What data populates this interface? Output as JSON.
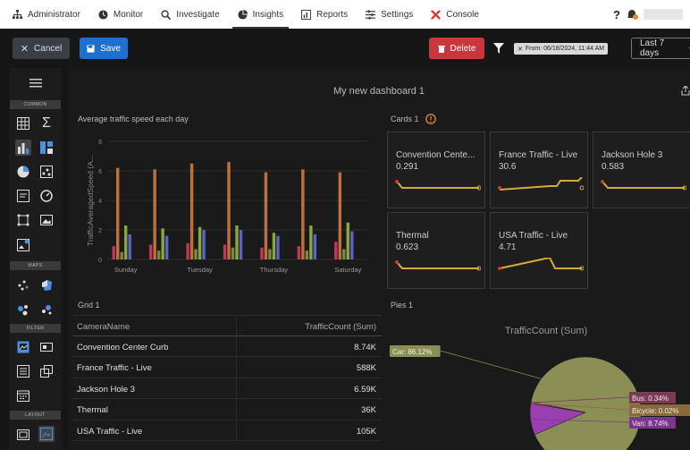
{
  "nav": {
    "items": [
      {
        "label": "Administrator",
        "icon": "org-chart-icon"
      },
      {
        "label": "Monitor",
        "icon": "clock-icon"
      },
      {
        "label": "Investigate",
        "icon": "search-icon"
      },
      {
        "label": "Insights",
        "icon": "pie-chart-icon"
      },
      {
        "label": "Reports",
        "icon": "report-icon"
      },
      {
        "label": "Settings",
        "icon": "settings-icon"
      },
      {
        "label": "Console",
        "icon": "console-icon"
      }
    ],
    "active": "Insights",
    "help": "?"
  },
  "toolbar": {
    "cancel_label": "Cancel",
    "save_label": "Save",
    "delete_label": "Delete",
    "filter_chip": "From: 06/18/2024, 11:44 AM",
    "range_label": "Last 7 days"
  },
  "sidebar": {
    "sections": [
      "COMMON",
      "MAPS",
      "FILTER",
      "LAYOUT"
    ]
  },
  "dashboard": {
    "title": "My new dashboard 1"
  },
  "bar_panel": {
    "title": "Average traffic speed each day"
  },
  "chart_data": {
    "type": "bar",
    "title": "Average traffic speed each day",
    "ylabel": "TrafficAveragedSpeed (A...",
    "xlabel": "",
    "ylim": [
      0,
      8
    ],
    "yticks": [
      "0",
      "2",
      "4",
      "6",
      "8"
    ],
    "categories": [
      "Sunday",
      "Monday",
      "Tuesday",
      "Wednesday",
      "Thursday",
      "Friday",
      "Saturday"
    ],
    "category_labels_shown": [
      "Sunday",
      "Tuesday",
      "Thursday",
      "Saturday"
    ],
    "series_colors": [
      "#c2385a",
      "#c0703a",
      "#7a8a3a",
      "#8aa83c",
      "#5b63c7",
      "#9b5a86",
      "#4e6e8a"
    ],
    "series": [
      {
        "values": [
          0.9,
          6.2,
          0.5,
          2.3,
          1.7,
          0.0,
          0.0
        ]
      },
      {
        "values": [
          1.0,
          6.1,
          0.6,
          2.1,
          1.6,
          0.0,
          0.0
        ]
      },
      {
        "values": [
          1.1,
          6.5,
          0.7,
          2.2,
          2.0,
          0.0,
          0.0
        ]
      },
      {
        "values": [
          1.0,
          6.6,
          0.8,
          2.3,
          2.0,
          0.0,
          0.0
        ]
      },
      {
        "values": [
          0.8,
          5.9,
          0.7,
          1.8,
          1.6,
          0.0,
          0.0
        ]
      },
      {
        "values": [
          0.9,
          6.1,
          0.6,
          2.3,
          1.7,
          0.0,
          0.0
        ]
      },
      {
        "values": [
          1.2,
          5.9,
          0.7,
          2.5,
          1.9,
          0.0,
          0.0
        ]
      }
    ]
  },
  "cards_panel": {
    "title": "Cards 1",
    "cards": [
      {
        "title": "Convention Cente...",
        "value": "0.291"
      },
      {
        "title": "France Traffic - Live",
        "value": "30.6"
      },
      {
        "title": "Jackson Hole 3",
        "value": "0.583"
      },
      {
        "title": "Thermal",
        "value": "0.623"
      },
      {
        "title": "USA Traffic - Live",
        "value": "4.71"
      }
    ]
  },
  "grid_panel": {
    "title": "Grid 1",
    "columns": [
      "CameraName",
      "TrafficCount (Sum)"
    ],
    "rows": [
      [
        "Convention Center Curb",
        "8.74K"
      ],
      [
        "France Traffic - Live",
        "588K"
      ],
      [
        "Jackson Hole 3",
        "6.59K"
      ],
      [
        "Thermal",
        "36K"
      ],
      [
        "USA Traffic - Live",
        "105K"
      ]
    ]
  },
  "pie_panel": {
    "title": "Pies 1",
    "chart_title": "TrafficCount (Sum)",
    "slices": [
      {
        "label": "Car: 86.12%",
        "value": 86.12,
        "color": "#8c8f55"
      },
      {
        "label": "Van: 8.74%",
        "value": 8.74,
        "color": "#9a3fb0"
      },
      {
        "label": "Bicycle: 0.02%",
        "value": 0.02,
        "color": "#b07a30"
      },
      {
        "label": "Bus: 0.34%",
        "value": 0.34,
        "color": "#c04b7a"
      }
    ]
  }
}
